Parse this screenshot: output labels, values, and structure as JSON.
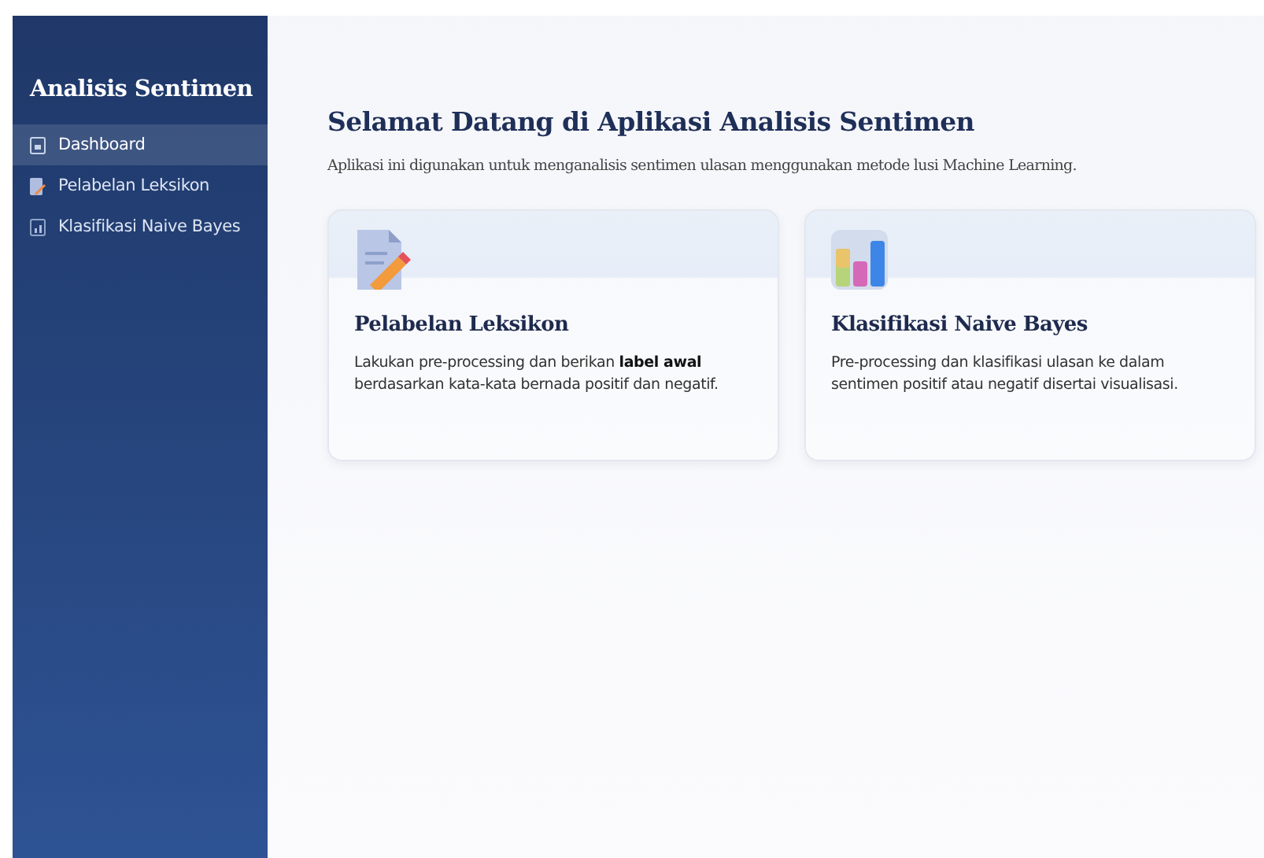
{
  "sidebar": {
    "title": "Analisis Sentimen",
    "items": [
      {
        "label": "Dashboard",
        "kind": "page",
        "selected": true
      },
      {
        "label": "Pelabelan Leksikon",
        "kind": "edit",
        "selected": false
      },
      {
        "label": "Klasifikasi Naive Bayes",
        "kind": "chart",
        "selected": false
      }
    ]
  },
  "main": {
    "title": "Selamat Datang di Aplikasi Analisis Sentimen",
    "subtitle": "Aplikasi ini digunakan untuk menganalisis sentimen ulasan menggunakan metode lusi Machine Learning.",
    "cards": [
      {
        "kind": "edit",
        "title": "Pelabelan Leksikon",
        "text": "Lakukan pre-processing dan berikan **label awal** berdasarkan kata-kata bernada positif dan negatif."
      },
      {
        "kind": "chart",
        "title": "Klasifikasi Naive Bayes",
        "text": "Pre-processing dan klasifikasi ulasan ke dalam sentimen positif atau negatif disertai visualisasi."
      }
    ]
  }
}
